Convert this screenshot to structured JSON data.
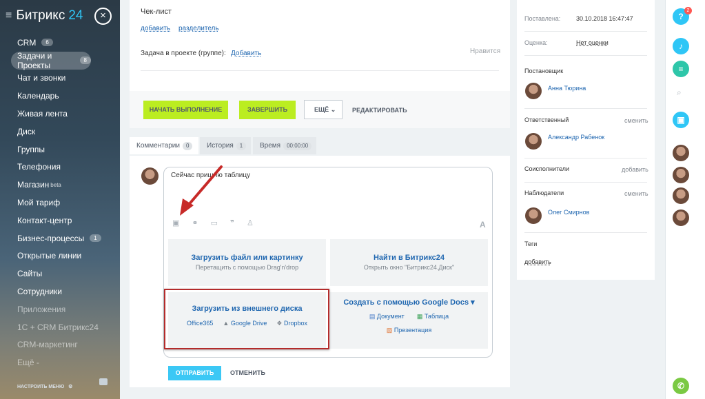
{
  "sidebar": {
    "logo_left": "Битрикс",
    "logo_right": "24",
    "items": [
      {
        "label": "CRM",
        "count": "6"
      },
      {
        "label": "Задачи и Проекты",
        "count": "8"
      },
      {
        "label": "Чат и звонки"
      },
      {
        "label": "Календарь"
      },
      {
        "label": "Живая лента"
      },
      {
        "label": "Диск"
      },
      {
        "label": "Группы"
      },
      {
        "label": "Телефония"
      },
      {
        "label": "Магазин",
        "sup": "beta"
      },
      {
        "label": "Мой тариф"
      },
      {
        "label": "Контакт-центр"
      },
      {
        "label": "Бизнес-процессы",
        "count": "1"
      },
      {
        "label": "Открытые линии"
      },
      {
        "label": "Сайты"
      },
      {
        "label": "Сотрудники"
      },
      {
        "label": "Приложения"
      },
      {
        "label": "1С + CRM Битрикс24"
      },
      {
        "label": "CRM-маркетинг"
      },
      {
        "label": "Ещё -"
      }
    ],
    "setup": "НАСТРОИТЬ МЕНЮ"
  },
  "task": {
    "checklist": "Чек-лист",
    "add": "добавить",
    "separator": "разделитель",
    "project_label": "Задача в проекте (группе):",
    "project_add": "Добавить",
    "like": "Нравится",
    "start": "НАЧАТЬ ВЫПОЛНЕНИЕ",
    "finish": "ЗАВЕРШИТЬ",
    "more": "ЕЩЁ",
    "edit": "РЕДАКТИРОВАТЬ"
  },
  "tabs": [
    {
      "label": "Комментарии",
      "count": "0"
    },
    {
      "label": "История",
      "count": "1"
    },
    {
      "label": "Время",
      "count": "00:00:00"
    }
  ],
  "editor": {
    "text": "Сейчас пришлю таблицу",
    "upload_title": "Загрузить файл или картинку",
    "upload_sub": "Перетащить с помощью Drag'n'drop",
    "find_title": "Найти в Битрикс24",
    "find_sub": "Открыть окно \"Битрикс24.Диск\"",
    "ext_title": "Загрузить из внешнего диска",
    "office": "Office365",
    "gdrive": "Google Drive",
    "dropbox": "Dropbox",
    "gdocs_title": "Создать с помощью Google Docs",
    "doc": "Документ",
    "table": "Таблица",
    "pres": "Презентация",
    "font_letter": "A"
  },
  "actions": {
    "send": "ОТПРАВИТЬ",
    "cancel": "ОТМЕНИТЬ"
  },
  "right": {
    "set_label": "Поставлена:",
    "set_value": "30.10.2018 16:47:47",
    "rating_label": "Оценка:",
    "rating_value": "Нет оценки",
    "creator_label": "Постановщик",
    "creator": "Анна Тюрина",
    "resp_label": "Ответственный",
    "change": "сменить",
    "resp": "Александр Рабенок",
    "co_label": "Соисполнители",
    "add": "добавить",
    "obs_label": "Наблюдатели",
    "change2": "сменить",
    "obs": "Олег Смирнов",
    "tags_label": "Теги",
    "tags_add": "добавить"
  },
  "strip": {
    "help_badge": "2",
    "help": "?"
  },
  "colors": {
    "accent": "#2fc6f6",
    "green": "#bbed21",
    "link": "#2067b0",
    "highlight": "#b42b2b"
  }
}
